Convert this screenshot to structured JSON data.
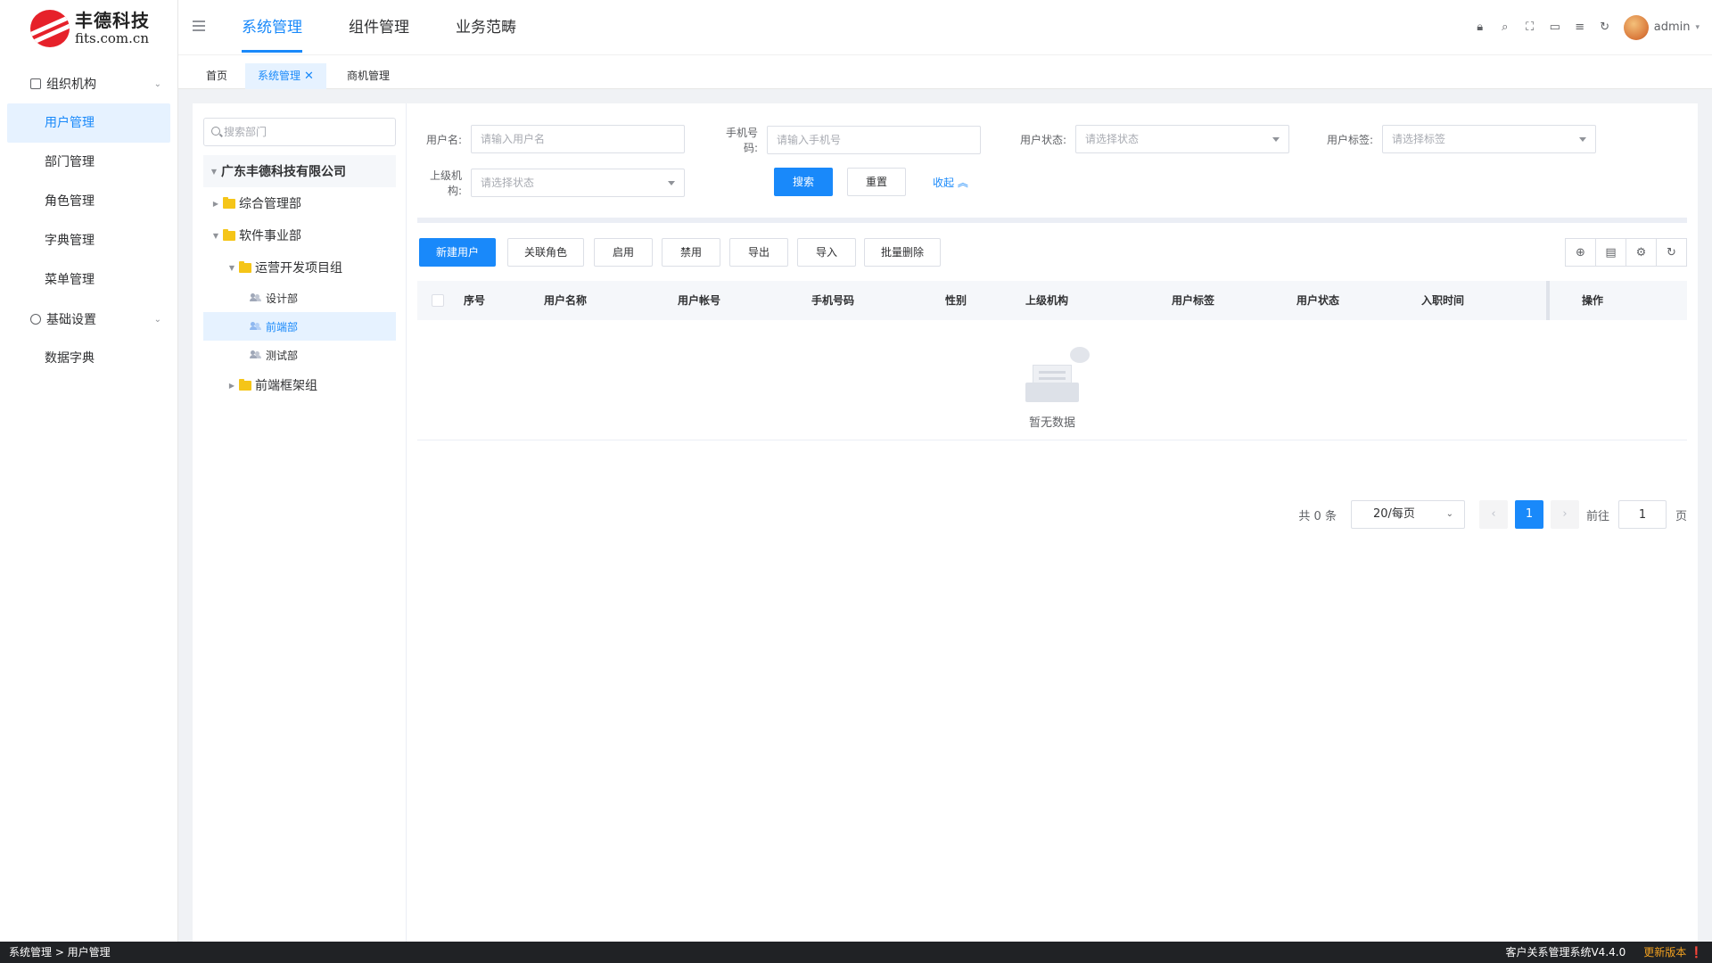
{
  "brand": {
    "name_cn": "丰德科技",
    "domain": "fits.com.cn"
  },
  "sidebar": {
    "groups": [
      {
        "label": "组织机构",
        "items": [
          "用户管理",
          "部门管理",
          "角色管理",
          "字典管理",
          "菜单管理"
        ]
      },
      {
        "label": "基础设置",
        "items": [
          "数据字典"
        ]
      }
    ],
    "active_item": "用户管理"
  },
  "topnav": {
    "items": [
      "系统管理",
      "组件管理",
      "业务范畴"
    ],
    "active": "系统管理"
  },
  "header": {
    "user_name": "admin"
  },
  "tabs": {
    "items": [
      "首页",
      "系统管理",
      "商机管理"
    ],
    "active": "系统管理"
  },
  "dept_tree": {
    "search_placeholder": "搜索部门",
    "root": "广东丰德科技有限公司",
    "nodes": {
      "n1": "综合管理部",
      "n2": "软件事业部",
      "n3": "运营开发项目组",
      "n4": "设计部",
      "n5": "前端部",
      "n6": "测试部",
      "n7": "前端框架组"
    },
    "selected": "前端部"
  },
  "filters": {
    "username_label": "用户名:",
    "username_placeholder": "请输入用户名",
    "phone_label": "手机号码:",
    "phone_placeholder": "请输入手机号",
    "status_label": "用户状态:",
    "status_placeholder": "请选择状态",
    "tag_label": "用户标签:",
    "tag_placeholder": "请选择标签",
    "org_label": "上级机构:",
    "org_placeholder": "请选择状态",
    "search_btn": "搜索",
    "reset_btn": "重置",
    "collapse_link": "收起"
  },
  "actions": [
    "新建用户",
    "关联角色",
    "启用",
    "禁用",
    "导出",
    "导入",
    "批量删除"
  ],
  "table": {
    "columns": [
      "序号",
      "用户名称",
      "用户帐号",
      "手机号码",
      "性别",
      "上级机构",
      "用户标签",
      "用户状态",
      "入职时间",
      "操作"
    ],
    "rows": [],
    "empty_text": "暂无数据"
  },
  "pagination": {
    "total_text": "共 0 条",
    "page_size": "20/每页",
    "current_page": "1",
    "goto_label": "前往",
    "goto_value": "1",
    "page_suffix": "页"
  },
  "statusbar": {
    "breadcrumb": "系统管理 > 用户管理",
    "system_version": "客户关系管理系统V4.4.0",
    "update_label": "更新版本"
  }
}
